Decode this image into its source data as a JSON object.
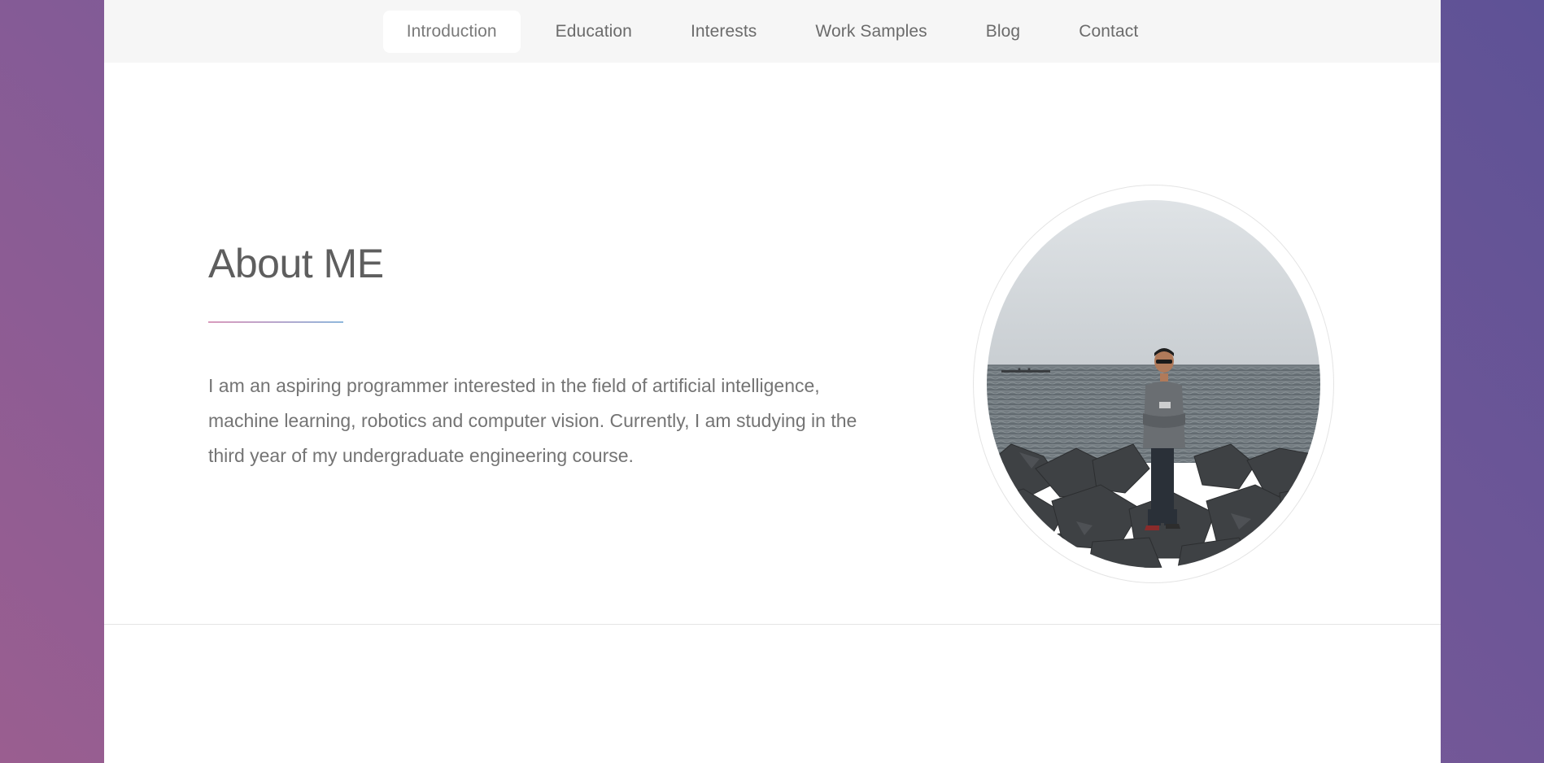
{
  "nav": {
    "items": [
      {
        "label": "Introduction",
        "active": true
      },
      {
        "label": "Education",
        "active": false
      },
      {
        "label": "Interests",
        "active": false
      },
      {
        "label": "Work Samples",
        "active": false
      },
      {
        "label": "Blog",
        "active": false
      },
      {
        "label": "Contact",
        "active": false
      }
    ]
  },
  "about": {
    "title": "About ME",
    "text": "I am an aspiring programmer interested in the field of artificial intelligence, machine learning, robotics and computer vision. Currently, I am studying in the third year of my undergraduate engineering course."
  },
  "colors": {
    "background_gradient_start": "#9a5e90",
    "background_gradient_end": "#5e5296",
    "nav_background": "#f6f6f6",
    "panel_background": "#ffffff",
    "divider_start": "#d99bbd",
    "divider_end": "#8fb8dc"
  }
}
